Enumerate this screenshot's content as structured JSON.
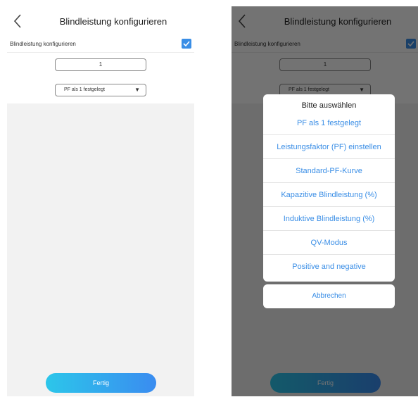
{
  "header": {
    "title": "Blindleistung konfigurieren"
  },
  "config_row": {
    "label": "Blindleistung konfigurieren",
    "checked": true
  },
  "number_input": {
    "value": "1"
  },
  "mode_select": {
    "value": "PF als 1 festgelegt"
  },
  "done_button": {
    "label": "Fertig"
  },
  "picker": {
    "title": "Bitte auswählen",
    "options": [
      "PF als 1 festgelegt",
      "Leistungsfaktor (PF) einstellen",
      "Standard-PF-Kurve",
      "Kapazitive Blindleistung (%)",
      "Induktive Blindleistung (%)",
      "QV-Modus",
      "Positive and negative"
    ],
    "cancel_label": "Abbrechen"
  },
  "colors": {
    "accent": "#3a8ee6",
    "button_gradient_start": "#2cc6ea",
    "button_gradient_end": "#3a8cf0",
    "page_background": "#f2f2f2"
  },
  "icons": {
    "back": "chevron-left-icon",
    "checkbox": "check-icon",
    "dropdown": "triangle-down-icon"
  }
}
